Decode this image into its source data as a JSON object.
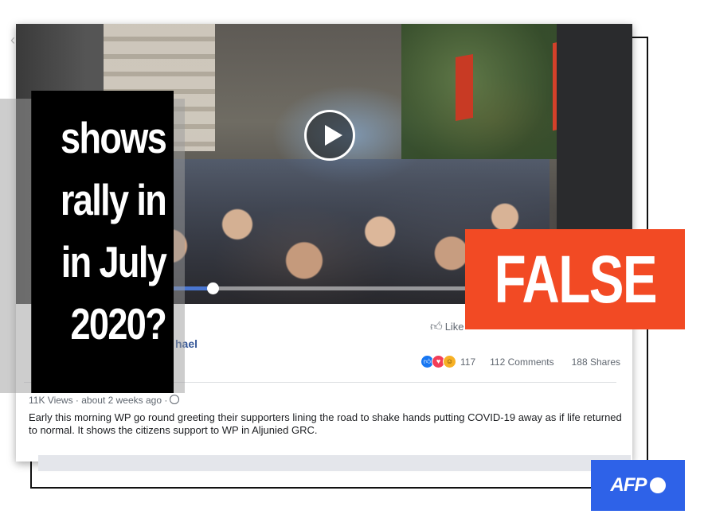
{
  "post": {
    "author_partial": "hael",
    "like_label": "Like",
    "reaction_count": "117",
    "comments": "112 Comments",
    "shares": "188 Shares",
    "views": "11K Views · about 2 weeks ago ·",
    "description": "Early this morning WP go round greeting their supporters lining the road to shake hands putting COVID-19 away as if life returned to normal. It shows the citizens support to WP in Aljunied GRC.",
    "video_progress": 0.28
  },
  "overlay": {
    "question_lines": [
      "shows",
      "rally in",
      "in July",
      "2020?"
    ],
    "verdict": "FALSE",
    "verdict_color": "#f24a24",
    "logo_text": "AFP",
    "logo_color": "#2e62e8"
  },
  "icons": {
    "play": "play-icon",
    "thumb": "thumbs-up-icon",
    "globe": "globe-icon",
    "reactions": [
      "like-reaction-icon",
      "love-reaction-icon",
      "haha-reaction-icon"
    ]
  }
}
